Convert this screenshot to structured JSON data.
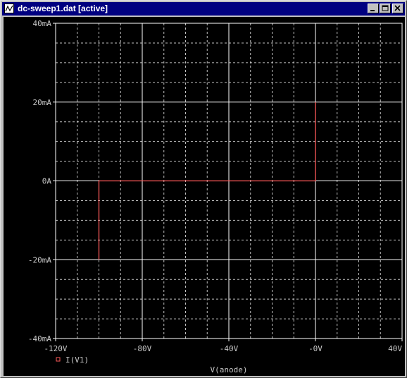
{
  "window": {
    "title": "dc-sweep1.dat [active]",
    "buttons": [
      "minimize",
      "maximize",
      "close"
    ]
  },
  "colors": {
    "background": "#000000",
    "grid": "#ffffff",
    "trace": "#ff5a5a",
    "titlebar": "#000080"
  },
  "chart_data": {
    "type": "line",
    "xlabel": "V(anode)",
    "ylabel": "",
    "xlim": [
      -120,
      40
    ],
    "ylim": [
      -40,
      40
    ],
    "x_ticks": [
      -120,
      -80,
      -40,
      0,
      40
    ],
    "x_tick_labels": [
      "-120V",
      "-80V",
      "-40V",
      "-0V",
      "40V"
    ],
    "y_ticks": [
      40,
      20,
      0,
      -20,
      -40
    ],
    "y_tick_labels": [
      "40mA",
      "20mA",
      "0A",
      "-20mA",
      "-40mA"
    ],
    "grid": true,
    "legend": "bottom-left",
    "series": [
      {
        "name": "I(V1)",
        "x": [
          -100,
          -100,
          -50,
          0,
          0
        ],
        "y": [
          -20,
          0,
          0,
          0,
          20
        ]
      }
    ]
  }
}
